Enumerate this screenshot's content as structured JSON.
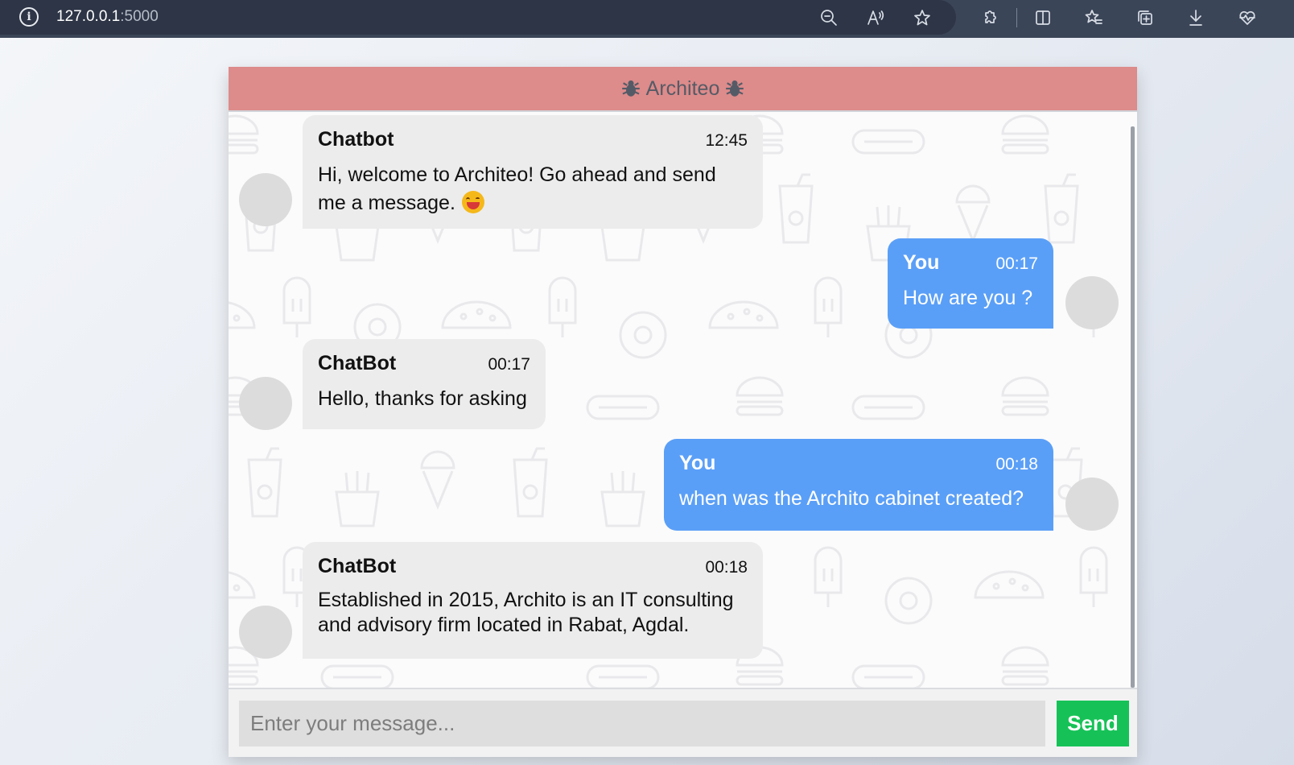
{
  "browser": {
    "url_host": "127.0.0.1",
    "url_port": ":5000",
    "toolbar_icons": [
      "zoom-out-icon",
      "read-aloud-icon",
      "favorite-star-icon",
      "extensions-icon",
      "split-screen-icon",
      "favorites-icon",
      "collections-icon",
      "downloads-icon",
      "browser-essentials-icon"
    ]
  },
  "chat": {
    "title": "Architeo",
    "header_icon": "bug-icon",
    "header_color": "#dd8b8b",
    "messages": [
      {
        "sender": "Chatbot",
        "time": "12:45",
        "text": "Hi, welcome to Architeo! Go ahead and send me a message.",
        "emoji": "grinning-face-icon",
        "role": "bot"
      },
      {
        "sender": "You",
        "time": "00:17",
        "text": "How are you ?",
        "role": "user"
      },
      {
        "sender": "ChatBot",
        "time": "00:17",
        "text": "Hello, thanks for asking",
        "role": "bot"
      },
      {
        "sender": "You",
        "time": "00:18",
        "text": "when was the Archito cabinet created?",
        "role": "user"
      },
      {
        "sender": "ChatBot",
        "time": "00:18",
        "text": "Established in 2015, Archito is an IT consulting and advisory firm located in Rabat, Agdal.",
        "role": "bot"
      }
    ]
  },
  "composer": {
    "placeholder": "Enter your message...",
    "send_label": "Send",
    "send_color": "#16c257"
  },
  "colors": {
    "user_bubble": "#5a9ff7",
    "bot_bubble": "#ececec"
  }
}
